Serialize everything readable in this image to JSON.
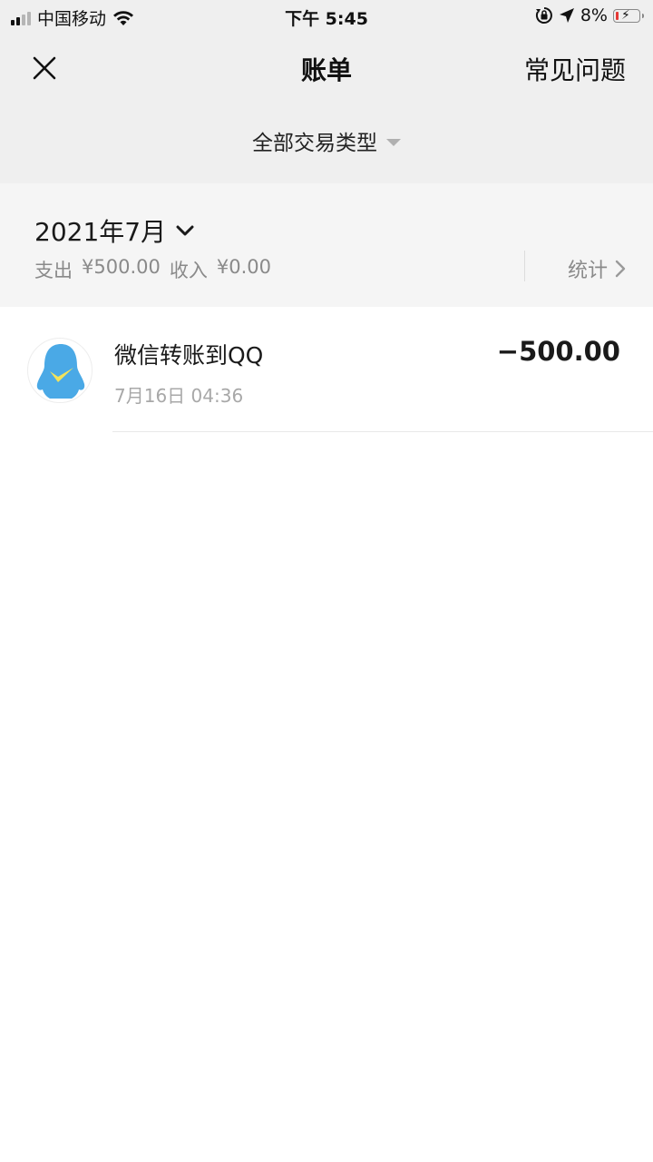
{
  "status_bar": {
    "carrier": "中国移动",
    "time": "下午 5:45",
    "battery": "8%"
  },
  "header": {
    "title": "账单",
    "faq_label": "常见问题"
  },
  "filter": {
    "label": "全部交易类型"
  },
  "month": {
    "label": "2021年7月",
    "expense_label": "支出",
    "expense_value": "¥500.00",
    "income_label": "收入",
    "income_value": "¥0.00",
    "stats_label": "统计"
  },
  "transactions": [
    {
      "name": "微信转账到QQ",
      "time": "7月16日 04:36",
      "amount": "−500.00",
      "icon": "qq-penguin-icon"
    }
  ],
  "colors": {
    "header_bg": "#efefef",
    "month_bg": "#f5f5f5",
    "qq_blue": "#4aa9e6",
    "qq_yellow": "#f3e35a",
    "battery_low": "#e53935"
  }
}
